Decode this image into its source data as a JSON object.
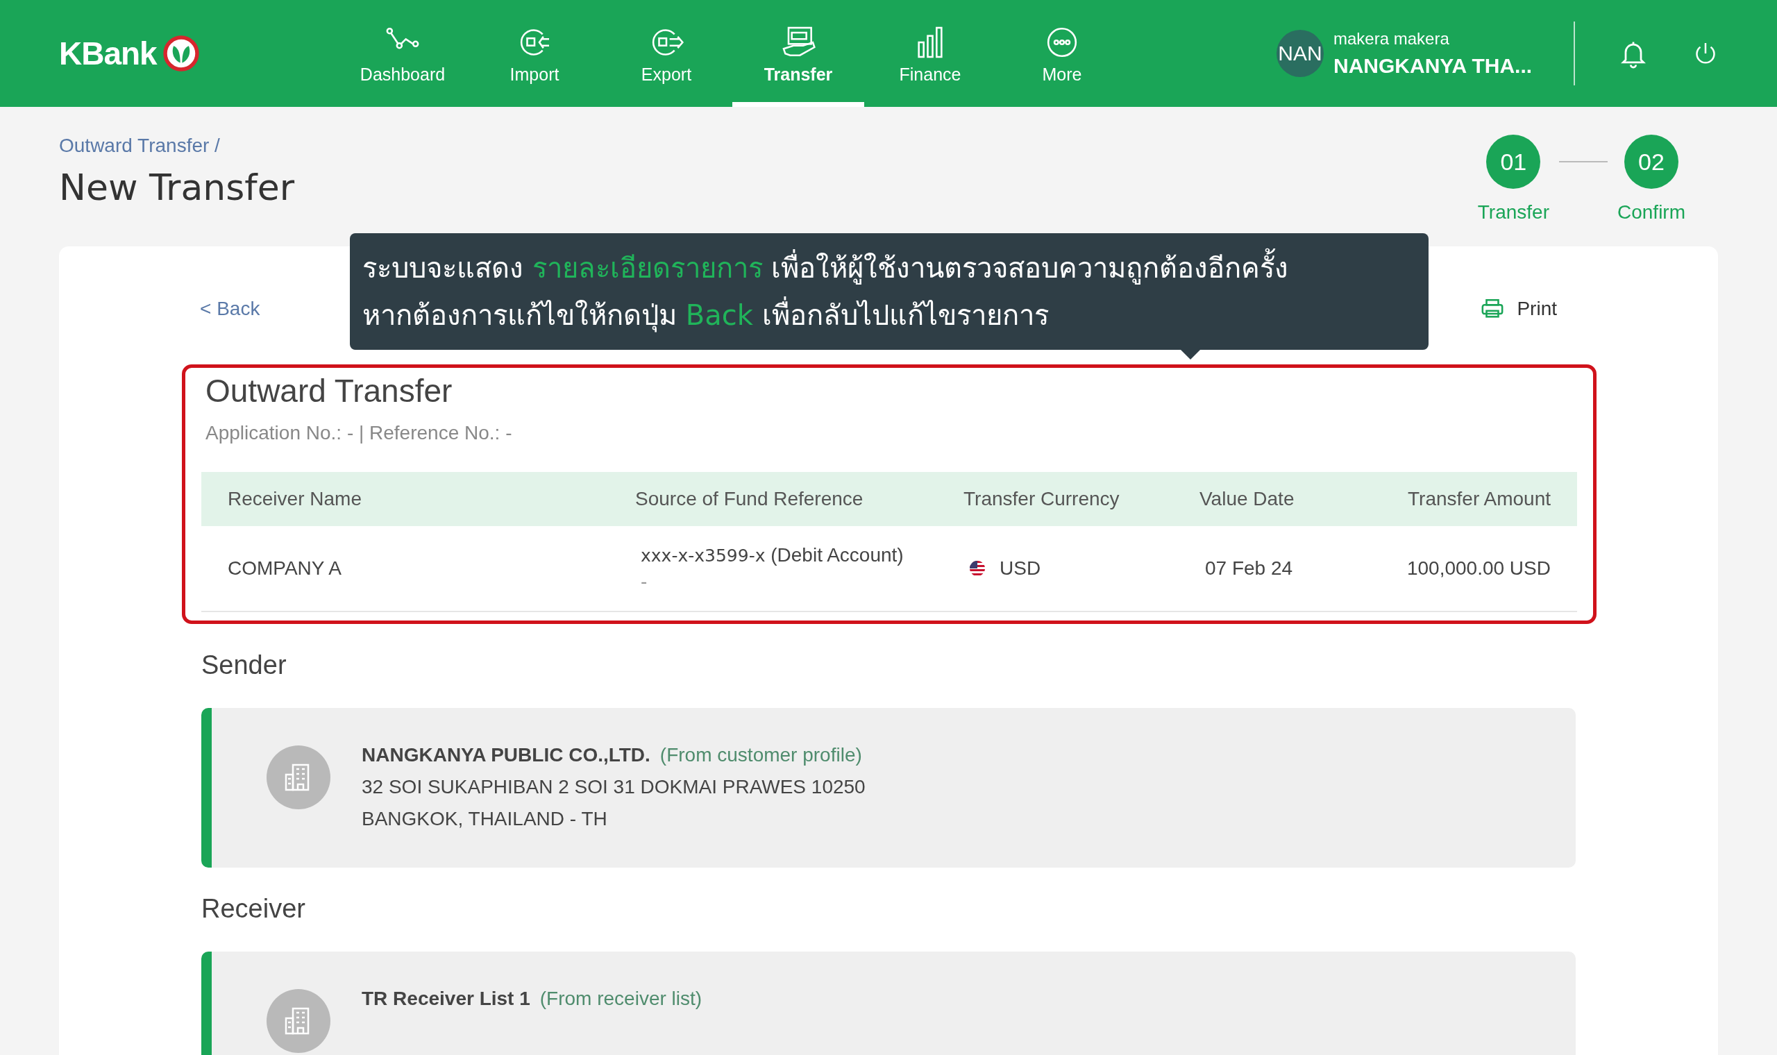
{
  "header": {
    "logo": "KBank",
    "nav": [
      {
        "label": "Dashboard",
        "selected": false
      },
      {
        "label": "Import",
        "selected": false
      },
      {
        "label": "Export",
        "selected": false
      },
      {
        "label": "Transfer",
        "selected": true
      },
      {
        "label": "Finance",
        "selected": false
      },
      {
        "label": "More",
        "selected": false
      }
    ],
    "user": {
      "initials": "NAN",
      "name": "makera makera",
      "company": "NANGKANYA THA..."
    }
  },
  "breadcrumb": "Outward Transfer /",
  "page_title": "New Transfer",
  "steps": [
    {
      "number": "01",
      "label": "Transfer"
    },
    {
      "number": "02",
      "label": "Confirm"
    }
  ],
  "back_link": "< Back",
  "print_button": "Print",
  "tooltip": {
    "lines": [
      [
        {
          "text": "ระบบจะแสดง ",
          "highlight": false
        },
        {
          "text": "รายละเอียดรายการ",
          "highlight": true
        },
        {
          "text": " เพื่อให้ผู้ใช้งานตรวจสอบความถูกต้องอีกครั้ง",
          "highlight": false
        }
      ],
      [
        {
          "text": "หากต้องการแก้ไขให้กดปุ่ม ",
          "highlight": false
        },
        {
          "text": "Back",
          "highlight": true
        },
        {
          "text": " เพื่อกลับไปแก้ไขรายการ",
          "highlight": false
        }
      ]
    ]
  },
  "summary": {
    "title": "Outward Transfer",
    "subtitle": "Application No.: - | Reference No.: -",
    "table": {
      "columns": [
        "Receiver Name",
        "Source of Fund Reference",
        "Transfer Currency",
        "Value Date",
        "Transfer Amount"
      ],
      "rows": [
        {
          "receiver": "COMPANY A",
          "source_account": "xxx-x-x3599-x",
          "source_type": "(Debit Account)",
          "source_note": "-",
          "currency": "USD",
          "value_date": "07 Feb 24",
          "amount": "100,000.00 USD"
        }
      ]
    }
  },
  "sections": [
    {
      "heading": "Sender",
      "name": "NANGKANYA PUBLIC CO.,LTD.",
      "origin": "(From customer profile)",
      "lines": [
        "32 SOI SUKAPHIBAN 2 SOI 31 DOKMAI PRAWES 10250",
        "BANGKOK, THAILAND - TH"
      ]
    },
    {
      "heading": "Receiver",
      "name": "TR Receiver List 1",
      "origin": "(From receiver list)"
    }
  ]
}
